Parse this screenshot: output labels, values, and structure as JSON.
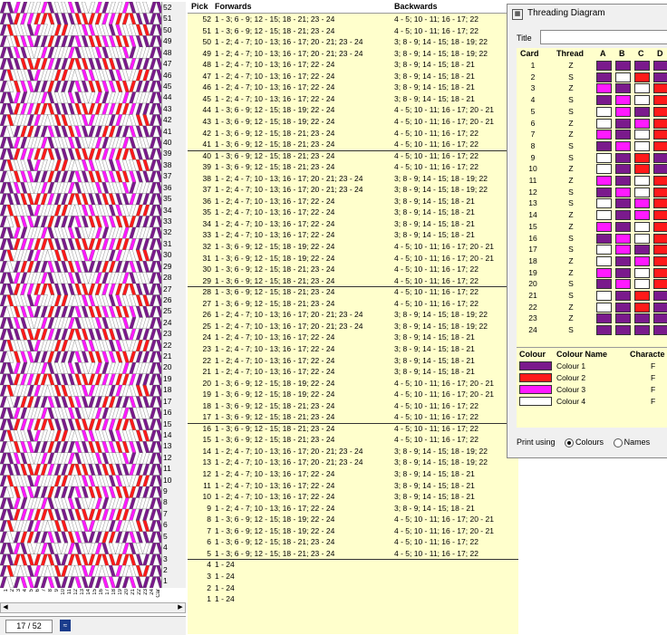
{
  "pattern": {
    "pick_numbers": [
      "52",
      "51",
      "50",
      "49",
      "48",
      "47",
      "46",
      "45",
      "44",
      "43",
      "42",
      "41",
      "40",
      "39",
      "38",
      "37",
      "36",
      "35",
      "34",
      "33",
      "32",
      "31",
      "30",
      "29",
      "28",
      "27",
      "26",
      "25",
      "24",
      "23",
      "22",
      "21",
      "20",
      "19",
      "18",
      "17",
      "16",
      "15",
      "14",
      "13",
      "12",
      "11",
      "10",
      "9",
      "8",
      "7",
      "6",
      "5",
      "4",
      "3",
      "2",
      "1"
    ],
    "card_numbers": [
      "1",
      "2",
      "3",
      "4",
      "5",
      "6",
      "7",
      "8",
      "9",
      "10",
      "11",
      "12",
      "13",
      "14",
      "15",
      "16",
      "17",
      "18",
      "19",
      "20",
      "21",
      "22",
      "23",
      "24",
      "Car"
    ]
  },
  "status": {
    "position": "17 / 52"
  },
  "pick_table": {
    "headers": {
      "pick": "Pick",
      "forwards": "Forwards",
      "backwards": "Backwards"
    },
    "rows": [
      [
        "52",
        "1 - 3; 6 - 9; 12 - 15; 18 - 21; 23 - 24",
        "4 - 5; 10 - 11; 16 - 17; 22"
      ],
      [
        "51",
        "1 - 3; 6 - 9; 12 - 15; 18 - 21; 23 - 24",
        "4 - 5; 10 - 11; 16 - 17; 22"
      ],
      [
        "50",
        "1 - 2; 4 - 7; 10 - 13; 16 - 17; 20 - 21; 23 - 24",
        "3; 8 - 9; 14 - 15; 18 - 19; 22"
      ],
      [
        "49",
        "1 - 2; 4 - 7; 10 - 13; 16 - 17; 20 - 21; 23 - 24",
        "3; 8 - 9; 14 - 15; 18 - 19; 22"
      ],
      [
        "48",
        "1 - 2; 4 - 7; 10 - 13; 16 - 17; 22 - 24",
        "3; 8 - 9; 14 - 15; 18 - 21"
      ],
      [
        "47",
        "1 - 2; 4 - 7; 10 - 13; 16 - 17; 22 - 24",
        "3; 8 - 9; 14 - 15; 18 - 21"
      ],
      [
        "46",
        "1 - 2; 4 - 7; 10 - 13; 16 - 17; 22 - 24",
        "3; 8 - 9; 14 - 15; 18 - 21"
      ],
      [
        "45",
        "1 - 2; 4 - 7; 10 - 13; 16 - 17; 22 - 24",
        "3; 8 - 9; 14 - 15; 18 - 21"
      ],
      [
        "44",
        "1 - 3; 6 - 9; 12 - 15; 18 - 19; 22 - 24",
        "4 - 5; 10 - 11; 16 - 17; 20 - 21"
      ],
      [
        "43",
        "1 - 3; 6 - 9; 12 - 15; 18 - 19; 22 - 24",
        "4 - 5; 10 - 11; 16 - 17; 20 - 21"
      ],
      [
        "42",
        "1 - 3; 6 - 9; 12 - 15; 18 - 21; 23 - 24",
        "4 - 5; 10 - 11; 16 - 17; 22"
      ],
      [
        "41",
        "1 - 3; 6 - 9; 12 - 15; 18 - 21; 23 - 24",
        "4 - 5; 10 - 11; 16 - 17; 22"
      ],
      [
        "40",
        "1 - 3; 6 - 9; 12 - 15; 18 - 21; 23 - 24",
        "4 - 5; 10 - 11; 16 - 17; 22"
      ],
      [
        "39",
        "1 - 3; 6 - 9; 12 - 15; 18 - 21; 23 - 24",
        "4 - 5; 10 - 11; 16 - 17; 22"
      ],
      [
        "38",
        "1 - 2; 4 - 7; 10 - 13; 16 - 17; 20 - 21; 23 - 24",
        "3; 8 - 9; 14 - 15; 18 - 19; 22"
      ],
      [
        "37",
        "1 - 2; 4 - 7; 10 - 13; 16 - 17; 20 - 21; 23 - 24",
        "3; 8 - 9; 14 - 15; 18 - 19; 22"
      ],
      [
        "36",
        "1 - 2; 4 - 7; 10 - 13; 16 - 17; 22 - 24",
        "3; 8 - 9; 14 - 15; 18 - 21"
      ],
      [
        "35",
        "1 - 2; 4 - 7; 10 - 13; 16 - 17; 22 - 24",
        "3; 8 - 9; 14 - 15; 18 - 21"
      ],
      [
        "34",
        "1 - 2; 4 - 7; 10 - 13; 16 - 17; 22 - 24",
        "3; 8 - 9; 14 - 15; 18 - 21"
      ],
      [
        "33",
        "1 - 2; 4 - 7; 10 - 13; 16 - 17; 22 - 24",
        "3; 8 - 9; 14 - 15; 18 - 21"
      ],
      [
        "32",
        "1 - 3; 6 - 9; 12 - 15; 18 - 19; 22 - 24",
        "4 - 5; 10 - 11; 16 - 17; 20 - 21"
      ],
      [
        "31",
        "1 - 3; 6 - 9; 12 - 15; 18 - 19; 22 - 24",
        "4 - 5; 10 - 11; 16 - 17; 20 - 21"
      ],
      [
        "30",
        "1 - 3; 6 - 9; 12 - 15; 18 - 21; 23 - 24",
        "4 - 5; 10 - 11; 16 - 17; 22"
      ],
      [
        "29",
        "1 - 3; 6 - 9; 12 - 15; 18 - 21; 23 - 24",
        "4 - 5; 10 - 11; 16 - 17; 22"
      ],
      [
        "28",
        "1 - 3; 6 - 9; 12 - 15; 18 - 21; 23 - 24",
        "4 - 5; 10 - 11; 16 - 17; 22"
      ],
      [
        "27",
        "1 - 3; 6 - 9; 12 - 15; 18 - 21; 23 - 24",
        "4 - 5; 10 - 11; 16 - 17; 22"
      ],
      [
        "26",
        "1 - 2; 4 - 7; 10 - 13; 16 - 17; 20 - 21; 23 - 24",
        "3; 8 - 9; 14 - 15; 18 - 19; 22"
      ],
      [
        "25",
        "1 - 2; 4 - 7; 10 - 13; 16 - 17; 20 - 21; 23 - 24",
        "3; 8 - 9; 14 - 15; 18 - 19; 22"
      ],
      [
        "24",
        "1 - 2; 4 - 7; 10 - 13; 16 - 17; 22 - 24",
        "3; 8 - 9; 14 - 15; 18 - 21"
      ],
      [
        "23",
        "1 - 2; 4 - 7; 10 - 13; 16 - 17; 22 - 24",
        "3; 8 - 9; 14 - 15; 18 - 21"
      ],
      [
        "22",
        "1 - 2; 4 - 7; 10 - 13; 16 - 17; 22 - 24",
        "3; 8 - 9; 14 - 15; 18 - 21"
      ],
      [
        "21",
        "1 - 2; 4 - 7; 10 - 13; 16 - 17; 22 - 24",
        "3; 8 - 9; 14 - 15; 18 - 21"
      ],
      [
        "20",
        "1 - 3; 6 - 9; 12 - 15; 18 - 19; 22 - 24",
        "4 - 5; 10 - 11; 16 - 17; 20 - 21"
      ],
      [
        "19",
        "1 - 3; 6 - 9; 12 - 15; 18 - 19; 22 - 24",
        "4 - 5; 10 - 11; 16 - 17; 20 - 21"
      ],
      [
        "18",
        "1 - 3; 6 - 9; 12 - 15; 18 - 21; 23 - 24",
        "4 - 5; 10 - 11; 16 - 17; 22"
      ],
      [
        "17",
        "1 - 3; 6 - 9; 12 - 15; 18 - 21; 23 - 24",
        "4 - 5; 10 - 11; 16 - 17; 22"
      ],
      [
        "16",
        "1 - 3; 6 - 9; 12 - 15; 18 - 21; 23 - 24",
        "4 - 5; 10 - 11; 16 - 17; 22"
      ],
      [
        "15",
        "1 - 3; 6 - 9; 12 - 15; 18 - 21; 23 - 24",
        "4 - 5; 10 - 11; 16 - 17; 22"
      ],
      [
        "14",
        "1 - 2; 4 - 7; 10 - 13; 16 - 17; 20 - 21; 23 - 24",
        "3; 8 - 9; 14 - 15; 18 - 19; 22"
      ],
      [
        "13",
        "1 - 2; 4 - 7; 10 - 13; 16 - 17; 20 - 21; 23 - 24",
        "3; 8 - 9; 14 - 15; 18 - 19; 22"
      ],
      [
        "12",
        "1 - 2; 4 - 7; 10 - 13; 16 - 17; 22 - 24",
        "3; 8 - 9; 14 - 15; 18 - 21"
      ],
      [
        "11",
        "1 - 2; 4 - 7; 10 - 13; 16 - 17; 22 - 24",
        "3; 8 - 9; 14 - 15; 18 - 21"
      ],
      [
        "10",
        "1 - 2; 4 - 7; 10 - 13; 16 - 17; 22 - 24",
        "3; 8 - 9; 14 - 15; 18 - 21"
      ],
      [
        "9",
        "1 - 2; 4 - 7; 10 - 13; 16 - 17; 22 - 24",
        "3; 8 - 9; 14 - 15; 18 - 21"
      ],
      [
        "8",
        "1 - 3; 6 - 9; 12 - 15; 18 - 19; 22 - 24",
        "4 - 5; 10 - 11; 16 - 17; 20 - 21"
      ],
      [
        "7",
        "1 - 3; 6 - 9; 12 - 15; 18 - 19; 22 - 24",
        "4 - 5; 10 - 11; 16 - 17; 20 - 21"
      ],
      [
        "6",
        "1 - 3; 6 - 9; 12 - 15; 18 - 21; 23 - 24",
        "4 - 5; 10 - 11; 16 - 17; 22"
      ],
      [
        "5",
        "1 - 3; 6 - 9; 12 - 15; 18 - 21; 23 - 24",
        "4 - 5; 10 - 11; 16 - 17; 22"
      ],
      [
        "4",
        "1 - 24",
        ""
      ],
      [
        "3",
        "1 - 24",
        ""
      ],
      [
        "2",
        "1 - 24",
        ""
      ],
      [
        "1",
        "1 - 24",
        ""
      ]
    ]
  },
  "threading_diagram": {
    "title": "Threading Diagram",
    "title_label": "Title",
    "title_value": "",
    "headers": {
      "card": "Card",
      "thread": "Thread",
      "a": "A",
      "b": "B",
      "c": "C",
      "d": "D"
    },
    "cards": [
      [
        "1",
        "Z",
        1,
        1,
        1,
        1
      ],
      [
        "2",
        "S",
        1,
        4,
        2,
        1
      ],
      [
        "3",
        "Z",
        3,
        1,
        4,
        2
      ],
      [
        "4",
        "S",
        1,
        3,
        4,
        2
      ],
      [
        "5",
        "S",
        4,
        3,
        1,
        2
      ],
      [
        "6",
        "Z",
        4,
        1,
        3,
        2
      ],
      [
        "7",
        "Z",
        3,
        1,
        4,
        2
      ],
      [
        "8",
        "S",
        1,
        3,
        4,
        2
      ],
      [
        "9",
        "S",
        4,
        1,
        2,
        1
      ],
      [
        "10",
        "Z",
        4,
        1,
        2,
        1
      ],
      [
        "11",
        "Z",
        3,
        1,
        4,
        2
      ],
      [
        "12",
        "S",
        1,
        3,
        4,
        2
      ],
      [
        "13",
        "S",
        4,
        1,
        3,
        2
      ],
      [
        "14",
        "Z",
        4,
        1,
        3,
        2
      ],
      [
        "15",
        "Z",
        3,
        1,
        4,
        2
      ],
      [
        "16",
        "S",
        1,
        3,
        4,
        2
      ],
      [
        "17",
        "S",
        4,
        3,
        1,
        2
      ],
      [
        "18",
        "Z",
        4,
        1,
        3,
        2
      ],
      [
        "19",
        "Z",
        3,
        1,
        4,
        2
      ],
      [
        "20",
        "S",
        1,
        3,
        4,
        2
      ],
      [
        "21",
        "S",
        4,
        1,
        2,
        1
      ],
      [
        "22",
        "Z",
        4,
        1,
        2,
        1
      ],
      [
        "23",
        "Z",
        1,
        1,
        1,
        1
      ],
      [
        "24",
        "S",
        1,
        1,
        1,
        1
      ]
    ],
    "colour_headers": {
      "colour": "Colour",
      "name": "Colour Name",
      "character": "Characte"
    },
    "colours": [
      {
        "name": "Colour 1",
        "char": "F",
        "hex": "#7a1a8c"
      },
      {
        "name": "Colour 2",
        "char": "F",
        "hex": "#ff1a1a"
      },
      {
        "name": "Colour 3",
        "char": "F",
        "hex": "#ff1aff"
      },
      {
        "name": "Colour 4",
        "char": "F",
        "hex": "#ffffff"
      }
    ],
    "print_using": {
      "label": "Print using",
      "opt1": "Colours",
      "opt2": "Names",
      "selected": "Colours"
    }
  }
}
